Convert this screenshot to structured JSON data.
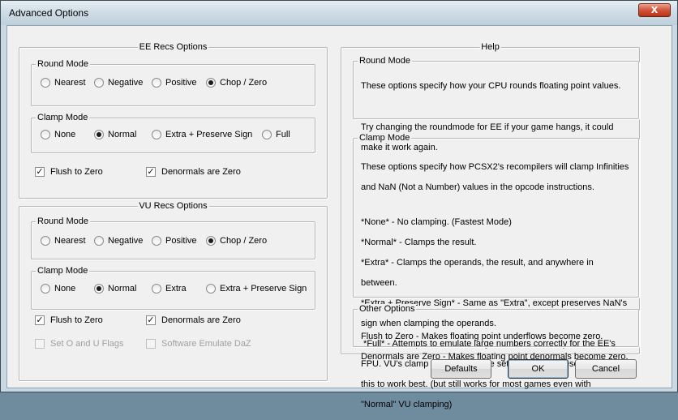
{
  "window": {
    "title": "Advanced Options",
    "close_glyph": "X"
  },
  "ee": {
    "title": "EE Recs Options",
    "round": {
      "title": "Round Mode",
      "options": [
        "Nearest",
        "Negative",
        "Positive",
        "Chop / Zero"
      ],
      "selected": "Chop / Zero"
    },
    "clamp": {
      "title": "Clamp Mode",
      "options": [
        "None",
        "Normal",
        "Extra + Preserve Sign",
        "Full"
      ],
      "selected": "Normal"
    },
    "flush_to_zero": {
      "label": "Flush to Zero",
      "checked": true
    },
    "denormals_are_zero": {
      "label": "Denormals are Zero",
      "checked": true
    }
  },
  "vu": {
    "title": "VU Recs Options",
    "round": {
      "title": "Round Mode",
      "options": [
        "Nearest",
        "Negative",
        "Positive",
        "Chop / Zero"
      ],
      "selected": "Chop / Zero"
    },
    "clamp": {
      "title": "Clamp Mode",
      "options": [
        "None",
        "Normal",
        "Extra",
        "Extra + Preserve Sign"
      ],
      "selected": "Normal"
    },
    "flush_to_zero": {
      "label": "Flush to Zero",
      "checked": true
    },
    "denormals_are_zero": {
      "label": "Denormals are Zero",
      "checked": true
    },
    "set_o_u_flags": {
      "label": "Set O and U Flags",
      "checked": false,
      "disabled": true
    },
    "software_emulate_daz": {
      "label": "Software Emulate DaZ",
      "checked": false,
      "disabled": true
    }
  },
  "help": {
    "title": "Help",
    "round": {
      "title": "Round Mode",
      "lines": [
        "These options specify how your CPU rounds floating point values.",
        "",
        "Try changing the roundmode for EE if your game hangs, it could",
        "make it work again."
      ]
    },
    "clamp": {
      "title": "Clamp Mode",
      "lines": [
        "These options specify how PCSX2's recompilers will clamp Infinities",
        "and NaN (Not a Number) values in the opcode instructions.",
        "",
        "*None* - No clamping. (Fastest Mode)",
        "*Normal* - Clamps the result.",
        "*Extra* - Clamps the operands, the result, and anywhere in",
        "between.",
        "*Extra + Preserve Sign* - Same as \"Extra\", except preserves NaN's",
        "sign when clamping the operands.",
        " *Full* - Attempts to emulate large numbers correctly for the EE's",
        "FPU. VU's clamp mode should be set to \"Extra + Preserve Sign\" for",
        "this to work best. (but still works for most games even with",
        "\"Normal\" VU clamping)"
      ]
    },
    "other": {
      "title": "Other Options",
      "lines": [
        "Flush to Zero - Makes floating point underflows become zero.",
        "Denormals are Zero - Makes floating point denormals become zero."
      ]
    }
  },
  "buttons": {
    "defaults": "Defaults",
    "ok": "OK",
    "cancel": "Cancel"
  }
}
